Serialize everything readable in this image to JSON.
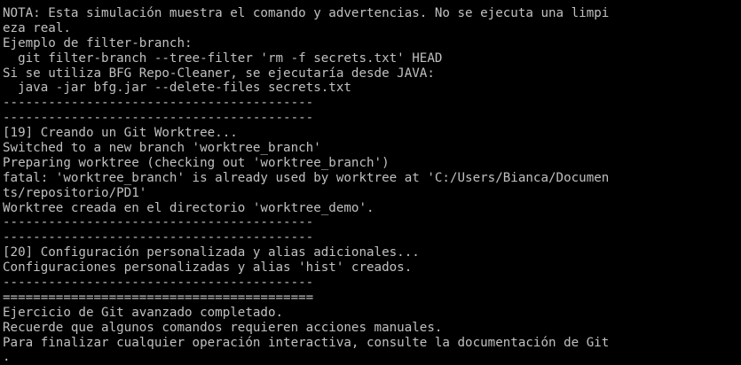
{
  "terminal": {
    "lines": [
      "NOTA: Esta simulación muestra el comando y advertencias. No se ejecuta una limpi",
      "eza real.",
      "Ejemplo de filter-branch:",
      "  git filter-branch --tree-filter 'rm -f secrets.txt' HEAD",
      "Si se utiliza BFG Repo-Cleaner, se ejecutaría desde JAVA:",
      "  java -jar bfg.jar --delete-files secrets.txt",
      "-----------------------------------------",
      "-----------------------------------------",
      "[19] Creando un Git Worktree...",
      "Switched to a new branch 'worktree_branch'",
      "Preparing worktree (checking out 'worktree_branch')",
      "fatal: 'worktree_branch' is already used by worktree at 'C:/Users/Bianca/Documen",
      "ts/repositorio/PD1'",
      "Worktree creada en el directorio 'worktree_demo'.",
      "-----------------------------------------",
      "-----------------------------------------",
      "[20] Configuración personalizada y alias adicionales...",
      "Configuraciones personalizadas y alias 'hist' creados.",
      "-----------------------------------------",
      "=========================================",
      "Ejercicio de Git avanzado completado.",
      "Recuerde que algunos comandos requieren acciones manuales.",
      "Para finalizar cualquier operación interactiva, consulte la documentación de Git",
      "."
    ]
  }
}
